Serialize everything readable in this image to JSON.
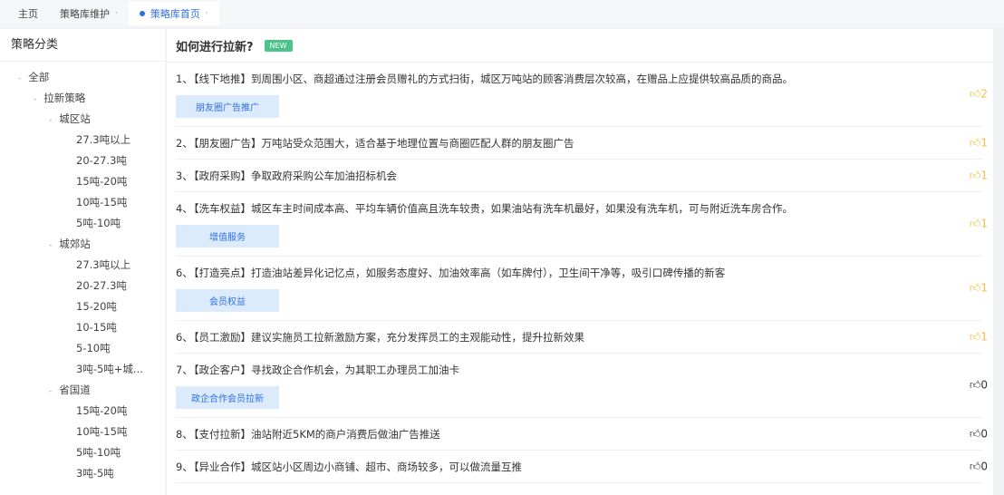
{
  "tabs": [
    {
      "label": "主页"
    },
    {
      "label": "策略库维护"
    },
    {
      "label": "策略库首页"
    }
  ],
  "sidebar": {
    "title": "策略分类",
    "tree": [
      {
        "label": "全部",
        "level": 0,
        "toggle": true
      },
      {
        "label": "拉新策略",
        "level": 1,
        "toggle": true
      },
      {
        "label": "城区站",
        "level": 2,
        "toggle": true
      },
      {
        "label": "27.3吨以上",
        "level": 3
      },
      {
        "label": "20-27.3吨",
        "level": 3
      },
      {
        "label": "15吨-20吨",
        "level": 3
      },
      {
        "label": "10吨-15吨",
        "level": 3
      },
      {
        "label": "5吨-10吨",
        "level": 3
      },
      {
        "label": "城郊站",
        "level": 2,
        "toggle": true
      },
      {
        "label": "27.3吨以上",
        "level": 3
      },
      {
        "label": "20-27.3吨",
        "level": 3
      },
      {
        "label": "15-20吨",
        "level": 3
      },
      {
        "label": "10-15吨",
        "level": 3
      },
      {
        "label": "5-10吨",
        "level": 3
      },
      {
        "label": "3吨-5吨+城...",
        "level": 3
      },
      {
        "label": "省国道",
        "level": 2,
        "toggle": true
      },
      {
        "label": "15吨-20吨",
        "level": 3
      },
      {
        "label": "10吨-15吨",
        "level": 3
      },
      {
        "label": "5吨-10吨",
        "level": 3
      },
      {
        "label": "3吨-5吨",
        "level": 3
      }
    ]
  },
  "main": {
    "title": "如何进行拉新?",
    "badge": "NEW",
    "items": [
      {
        "num": "1、",
        "cat": "【线下地推】",
        "text": "到周围小区、商超通过注册会员赠礼的方式扫街，城区万吨站的顾客消费层次较高，在赠品上应提供较高品质的商品。",
        "tag": "朋友圈广告推广",
        "likes": "2",
        "liked": true
      },
      {
        "num": "2、",
        "cat": "【朋友圈广告】",
        "text": "万吨站受众范围大，适合基于地理位置与商圈匹配人群的朋友圈广告",
        "tag": null,
        "likes": "1",
        "liked": true
      },
      {
        "num": "3、",
        "cat": "【政府采购】",
        "text": "争取政府采购公车加油招标机会",
        "tag": null,
        "likes": "1",
        "liked": true
      },
      {
        "num": "4、",
        "cat": "【洗车权益】",
        "text": "城区车主时间成本高、平均车辆价值高且洗车较贵，如果油站有洗车机最好，如果没有洗车机，可与附近洗车房合作。",
        "tag": "增值服务",
        "likes": "1",
        "liked": true
      },
      {
        "num": "6、",
        "cat": "【打造亮点】",
        "text": "打造油站差异化记忆点，如服务态度好、加油效率高（如车牌付），卫生间干净等，吸引口碑传播的新客",
        "tag": "会员权益",
        "likes": "1",
        "liked": true
      },
      {
        "num": "6、",
        "cat": "【员工激励】",
        "text": "建议实施员工拉新激励方案，充分发挥员工的主观能动性，提升拉新效果",
        "tag": null,
        "likes": "1",
        "liked": true
      },
      {
        "num": "7、",
        "cat": "【政企客户】",
        "text": "寻找政企合作机会，为其职工办理员工加油卡",
        "tag": "政企合作会员拉新",
        "likes": "0",
        "liked": false
      },
      {
        "num": "8、",
        "cat": "【支付拉新】",
        "text": "油站附近5KM的商户消费后做油广告推送",
        "tag": null,
        "likes": "0",
        "liked": false
      },
      {
        "num": "9、",
        "cat": "【异业合作】",
        "text": "城区站小区周边小商铺、超市、商场较多，可以做流量互推",
        "tag": null,
        "likes": "0",
        "liked": false
      }
    ]
  },
  "colors": {
    "accent": "#2f6fe0",
    "like": "#f0c040",
    "new_badge": "#4cc38a"
  }
}
